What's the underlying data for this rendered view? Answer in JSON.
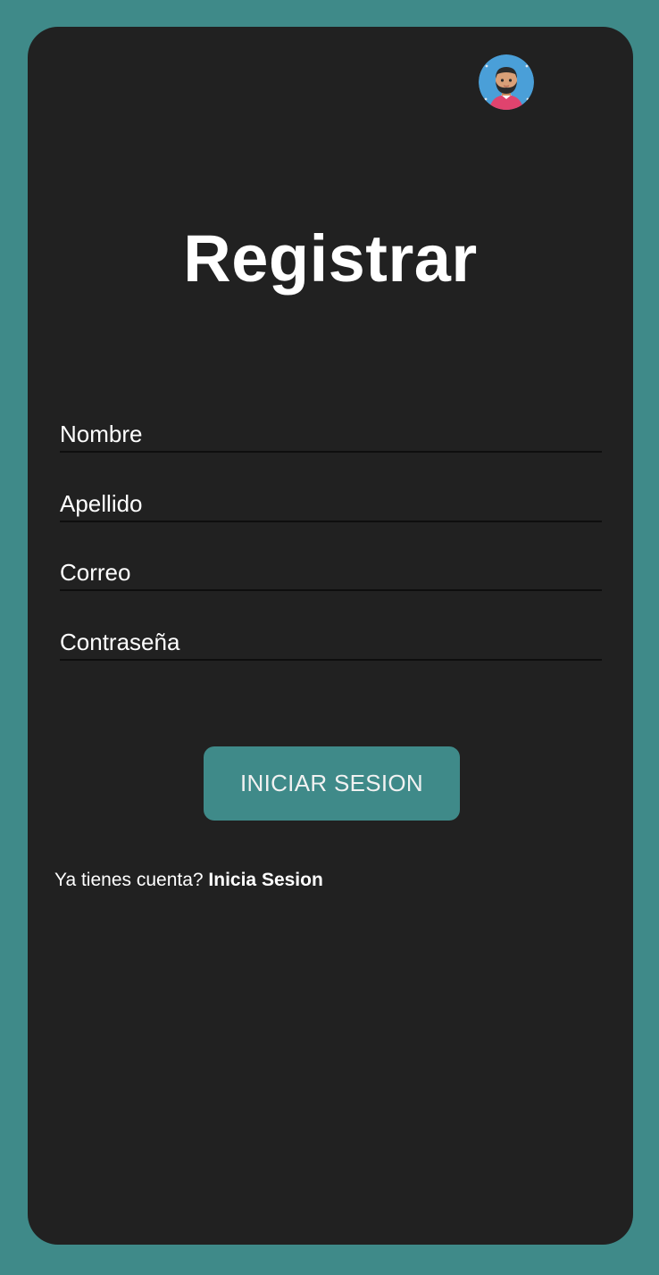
{
  "avatar": {
    "icon": "avatar-icon"
  },
  "title": "Registrar",
  "form": {
    "fields": [
      {
        "placeholder": "Nombre",
        "value": ""
      },
      {
        "placeholder": "Apellido",
        "value": ""
      },
      {
        "placeholder": "Correo",
        "value": ""
      },
      {
        "placeholder": "Contraseña",
        "value": ""
      }
    ],
    "submit_label": "INICIAR SESION"
  },
  "footer": {
    "prompt": "Ya tienes cuenta?",
    "link": "Inicia Sesion"
  },
  "colors": {
    "background": "#3f8a89",
    "card": "#212121",
    "accent": "#3f8a89",
    "text": "#ffffff"
  }
}
